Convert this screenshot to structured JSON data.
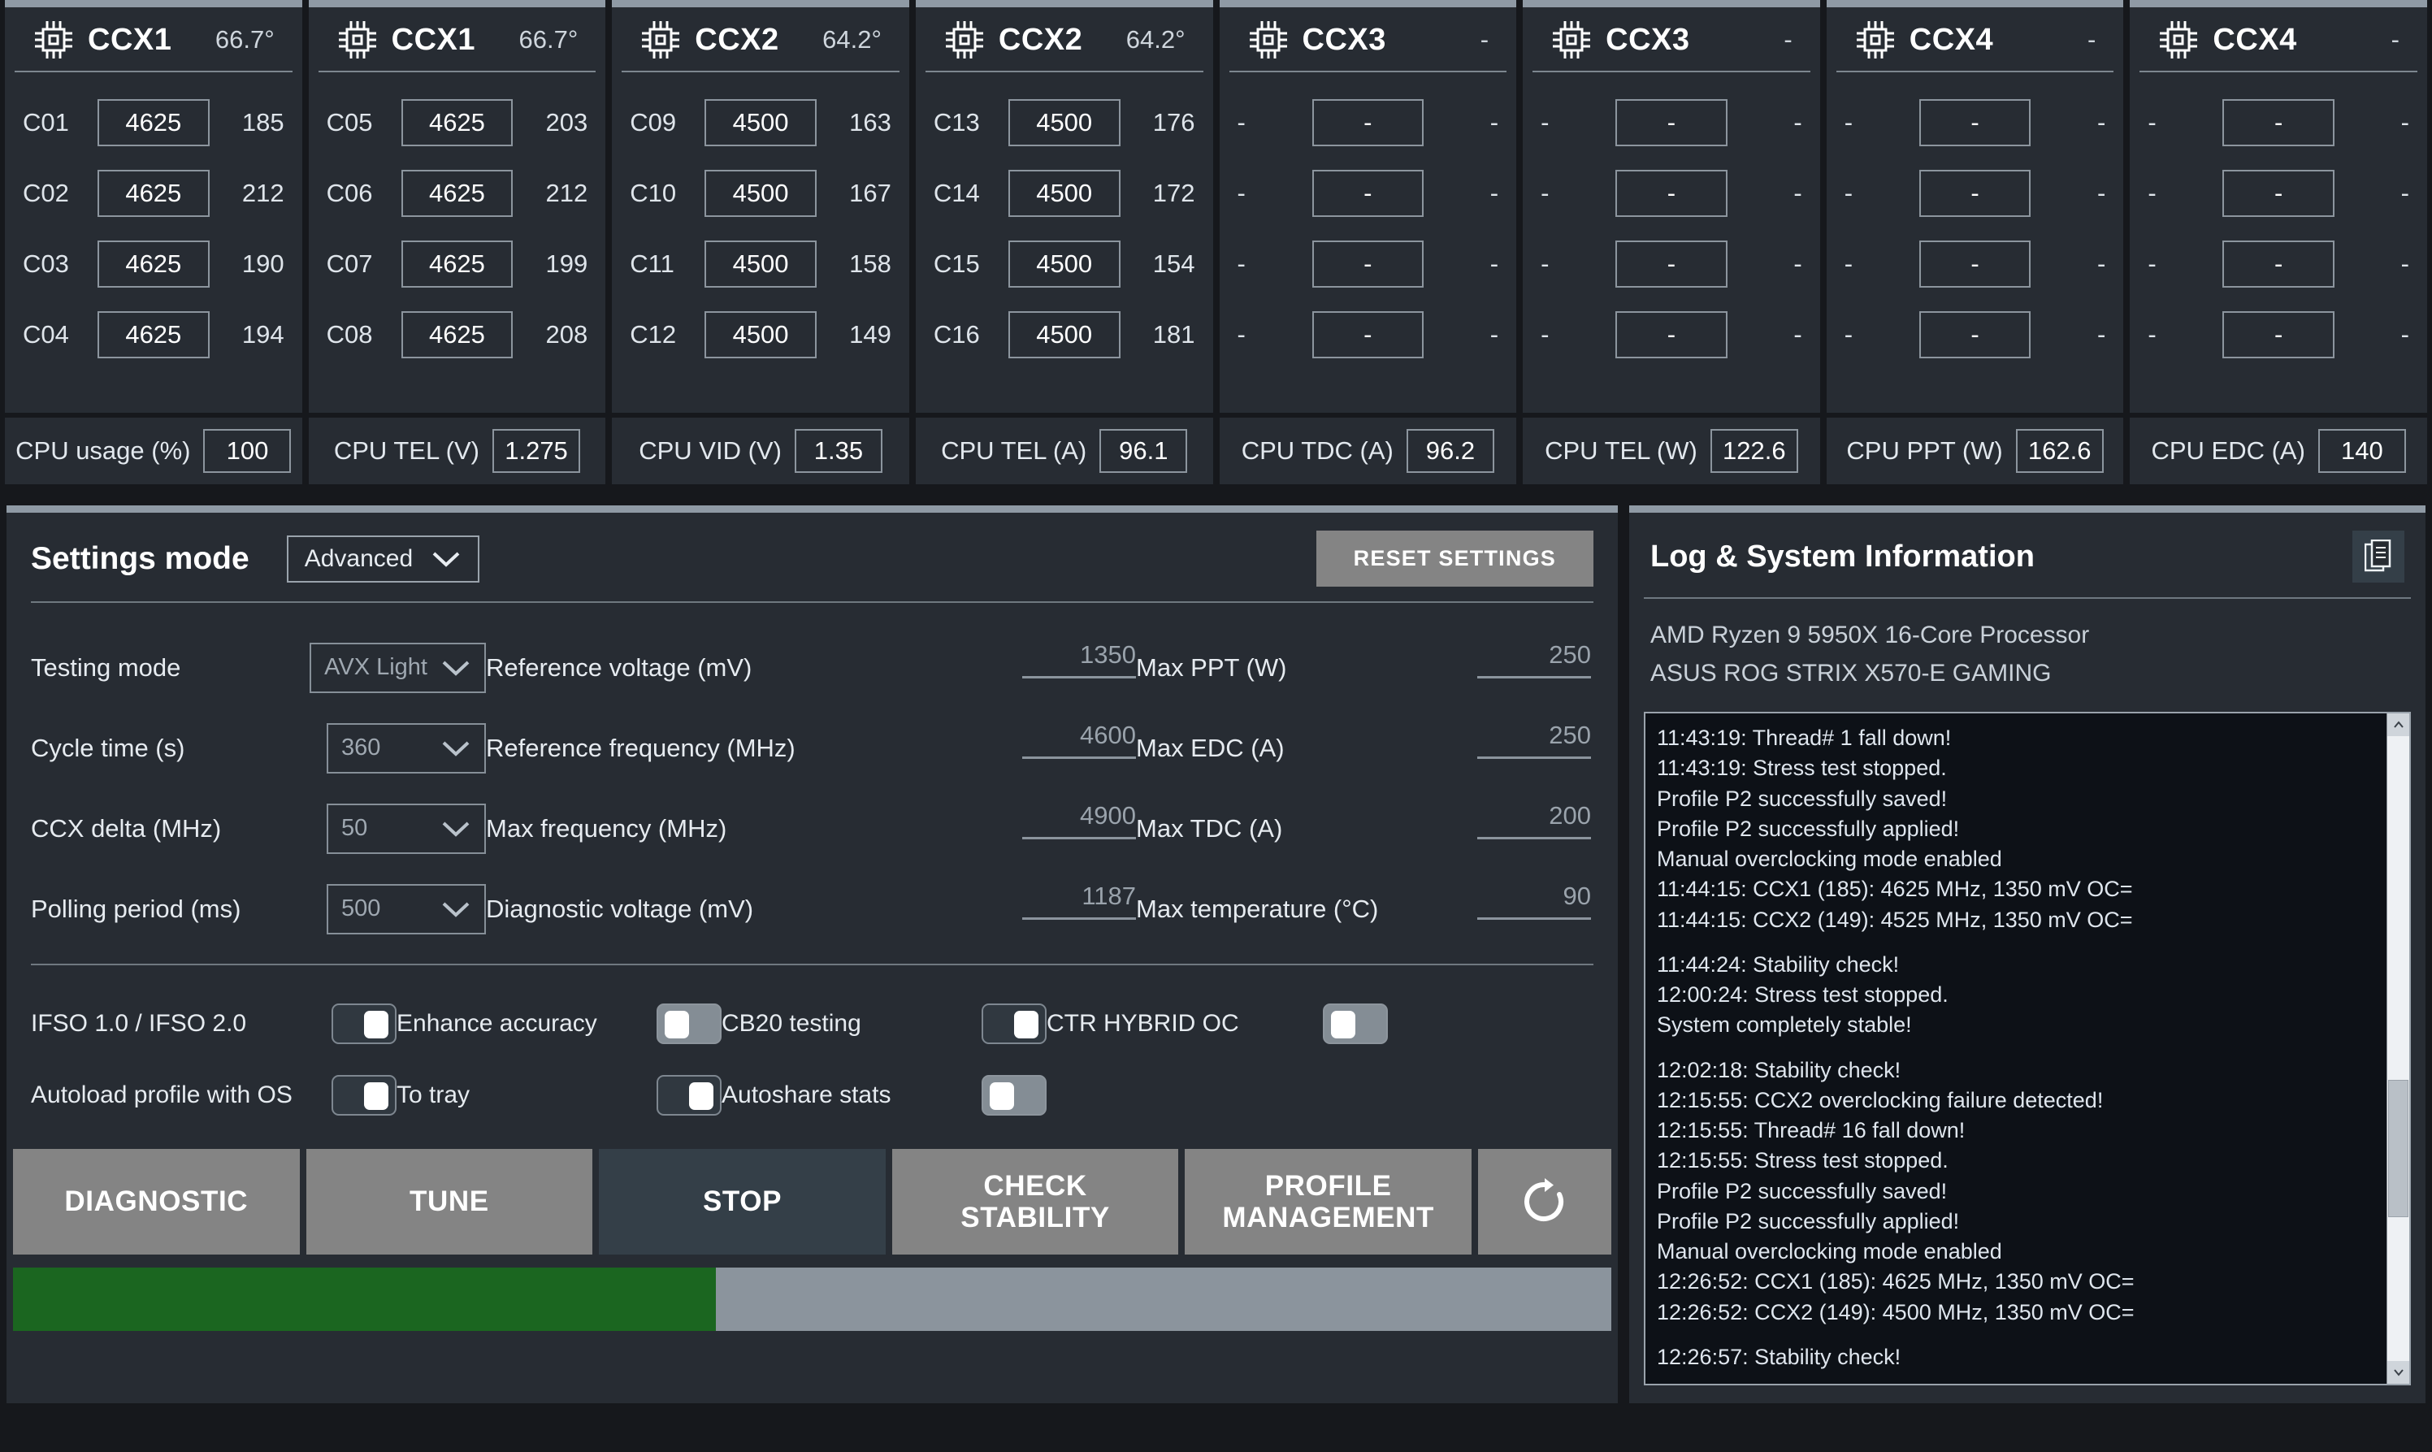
{
  "ccx_panels": [
    {
      "icon": "cpu-icon",
      "title": "CCX1",
      "temp": "66.7°",
      "cores": [
        {
          "label": "C01",
          "freq": "4625",
          "eff": "185"
        },
        {
          "label": "C02",
          "freq": "4625",
          "eff": "212"
        },
        {
          "label": "C03",
          "freq": "4625",
          "eff": "190"
        },
        {
          "label": "C04",
          "freq": "4625",
          "eff": "194"
        }
      ]
    },
    {
      "icon": "cpu-icon",
      "title": "CCX1",
      "temp": "66.7°",
      "cores": [
        {
          "label": "C05",
          "freq": "4625",
          "eff": "203"
        },
        {
          "label": "C06",
          "freq": "4625",
          "eff": "212"
        },
        {
          "label": "C07",
          "freq": "4625",
          "eff": "199"
        },
        {
          "label": "C08",
          "freq": "4625",
          "eff": "208"
        }
      ]
    },
    {
      "icon": "cpu-icon",
      "title": "CCX2",
      "temp": "64.2°",
      "cores": [
        {
          "label": "C09",
          "freq": "4500",
          "eff": "163"
        },
        {
          "label": "C10",
          "freq": "4500",
          "eff": "167"
        },
        {
          "label": "C11",
          "freq": "4500",
          "eff": "158"
        },
        {
          "label": "C12",
          "freq": "4500",
          "eff": "149"
        }
      ]
    },
    {
      "icon": "cpu-icon",
      "title": "CCX2",
      "temp": "64.2°",
      "cores": [
        {
          "label": "C13",
          "freq": "4500",
          "eff": "176"
        },
        {
          "label": "C14",
          "freq": "4500",
          "eff": "172"
        },
        {
          "label": "C15",
          "freq": "4500",
          "eff": "154"
        },
        {
          "label": "C16",
          "freq": "4500",
          "eff": "181"
        }
      ]
    },
    {
      "icon": "cpu-icon",
      "title": "CCX3",
      "temp": "-",
      "cores": [
        {
          "label": "-",
          "freq": "-",
          "eff": "-"
        },
        {
          "label": "-",
          "freq": "-",
          "eff": "-"
        },
        {
          "label": "-",
          "freq": "-",
          "eff": "-"
        },
        {
          "label": "-",
          "freq": "-",
          "eff": "-"
        }
      ]
    },
    {
      "icon": "cpu-icon",
      "title": "CCX3",
      "temp": "-",
      "cores": [
        {
          "label": "-",
          "freq": "-",
          "eff": "-"
        },
        {
          "label": "-",
          "freq": "-",
          "eff": "-"
        },
        {
          "label": "-",
          "freq": "-",
          "eff": "-"
        },
        {
          "label": "-",
          "freq": "-",
          "eff": "-"
        }
      ]
    },
    {
      "icon": "cpu-icon",
      "title": "CCX4",
      "temp": "-",
      "cores": [
        {
          "label": "-",
          "freq": "-",
          "eff": "-"
        },
        {
          "label": "-",
          "freq": "-",
          "eff": "-"
        },
        {
          "label": "-",
          "freq": "-",
          "eff": "-"
        },
        {
          "label": "-",
          "freq": "-",
          "eff": "-"
        }
      ]
    },
    {
      "icon": "cpu-icon",
      "title": "CCX4",
      "temp": "-",
      "cores": [
        {
          "label": "-",
          "freq": "-",
          "eff": "-"
        },
        {
          "label": "-",
          "freq": "-",
          "eff": "-"
        },
        {
          "label": "-",
          "freq": "-",
          "eff": "-"
        },
        {
          "label": "-",
          "freq": "-",
          "eff": "-"
        }
      ]
    }
  ],
  "metrics": [
    {
      "label": "CPU usage (%)",
      "value": "100"
    },
    {
      "label": "CPU TEL (V)",
      "value": "1.275"
    },
    {
      "label": "CPU VID (V)",
      "value": "1.35"
    },
    {
      "label": "CPU TEL (A)",
      "value": "96.1"
    },
    {
      "label": "CPU TDC (A)",
      "value": "96.2"
    },
    {
      "label": "CPU TEL (W)",
      "value": "122.6"
    },
    {
      "label": "CPU PPT (W)",
      "value": "162.6"
    },
    {
      "label": "CPU EDC (A)",
      "value": "140"
    }
  ],
  "settings": {
    "title": "Settings mode",
    "mode_value": "Advanced",
    "reset_label": "RESET SETTINGS",
    "left_column": [
      {
        "label": "Testing mode",
        "value": "AVX Light"
      },
      {
        "label": "Cycle time (s)",
        "value": "360"
      },
      {
        "label": "CCX delta (MHz)",
        "value": "50"
      },
      {
        "label": "Polling period (ms)",
        "value": "500"
      }
    ],
    "mid_column": [
      {
        "label": "Reference voltage (mV)",
        "value": "1350"
      },
      {
        "label": "Reference frequency (MHz)",
        "value": "4600"
      },
      {
        "label": "Max frequency (MHz)",
        "value": "4900"
      },
      {
        "label": "Diagnostic voltage (mV)",
        "value": "1187"
      }
    ],
    "right_column": [
      {
        "label": "Max PPT (W)",
        "value": "250"
      },
      {
        "label": "Max EDC (A)",
        "value": "250"
      },
      {
        "label": "Max TDC (A)",
        "value": "200"
      },
      {
        "label": "Max temperature (°C)",
        "value": "90"
      }
    ],
    "toggles": [
      {
        "label": "IFSO 1.0 / IFSO 2.0",
        "state": "on"
      },
      {
        "label": "Autoload profile with OS",
        "state": "on"
      },
      {
        "label": "Enhance accuracy",
        "state": "off"
      },
      {
        "label": "To tray",
        "state": "on"
      },
      {
        "label": "CB20 testing",
        "state": "on"
      },
      {
        "label": "Autoshare stats",
        "state": "off"
      },
      {
        "label": "CTR HYBRID OC",
        "state": "off"
      }
    ],
    "actions": [
      {
        "label": "DIAGNOSTIC",
        "style": "normal"
      },
      {
        "label": "TUNE",
        "style": "normal"
      },
      {
        "label": "STOP",
        "style": "dark"
      },
      {
        "label": "CHECK\nSTABILITY",
        "style": "normal"
      },
      {
        "label": "PROFILE\nMANAGEMENT",
        "style": "normal"
      }
    ],
    "refresh_icon": "refresh-icon",
    "progress_percent": 44
  },
  "log": {
    "title": "Log & System Information",
    "copy_icon": "copy-icon",
    "cpu": "AMD Ryzen 9 5950X 16-Core Processor",
    "motherboard": "ASUS ROG STRIX X570-E GAMING",
    "entries": [
      "11:43:19: Thread# 1 fall down!",
      "11:43:19: Stress test stopped.",
      "Profile P2 successfully saved!",
      "Profile P2 successfully applied!",
      "Manual overclocking mode enabled",
      "11:44:15: CCX1 (185): 4625 MHz, 1350 mV  OC=",
      "11:44:15: CCX2 (149): 4525 MHz, 1350 mV  OC=",
      "",
      "11:44:24: Stability check!",
      "12:00:24: Stress test stopped.",
      "System completely stable!",
      "",
      "12:02:18: Stability check!",
      "12:15:55: CCX2 overclocking failure detected!",
      "12:15:55: Thread# 16 fall down!",
      "12:15:55: Stress test stopped.",
      "Profile P2 successfully saved!",
      "Profile P2 successfully applied!",
      "Manual overclocking mode enabled",
      "12:26:52: CCX1 (185): 4625 MHz, 1350 mV  OC=",
      "12:26:52: CCX2 (149): 4500 MHz, 1350 mV  OC=",
      "",
      "12:26:57: Stability check!"
    ]
  }
}
